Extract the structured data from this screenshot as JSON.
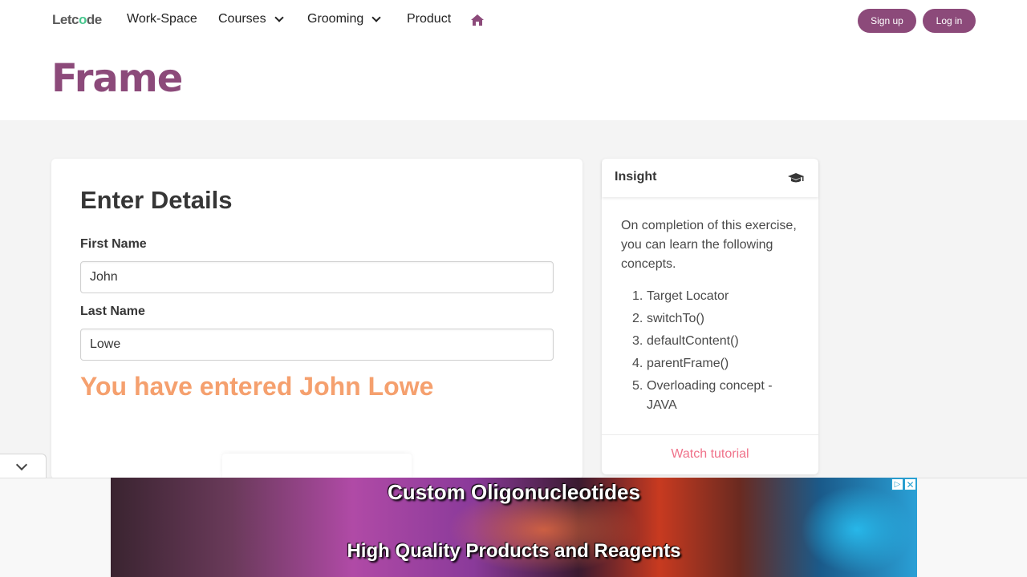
{
  "nav": {
    "logo_prefix": "Let",
    "logo_o": "o",
    "logo_suffix": "de",
    "items": [
      {
        "label": "Work-Space"
      },
      {
        "label": "Courses"
      },
      {
        "label": "Grooming"
      },
      {
        "label": "Product"
      }
    ],
    "home_icon": "home-icon",
    "signup": "Sign up",
    "login": "Log in"
  },
  "hero": {
    "title": "Frame"
  },
  "form": {
    "title": "Enter Details",
    "first_name_label": "First Name",
    "first_name_value": "John",
    "last_name_label": "Last Name",
    "last_name_value": "Lowe",
    "result": "You have entered John Lowe"
  },
  "insight": {
    "title": "Insight",
    "icon": "graduation-cap-icon",
    "description": "On completion of this exercise, you can learn the following concepts.",
    "concepts": [
      {
        "num": "1.",
        "text": "Target Locator"
      },
      {
        "num": "2.",
        "text": "switchTo()"
      },
      {
        "num": "3.",
        "text": "defaultContent()"
      },
      {
        "num": "4.",
        "text": "parentFrame()"
      },
      {
        "num": "5.",
        "text": "Overloading concept - JAVA"
      }
    ],
    "watch": "Watch tutorial"
  },
  "ad": {
    "line1": "Custom Oligonucleotides",
    "line2": "High Quality Products and Reagents",
    "info_glyph": "▷",
    "close_glyph": "✕"
  },
  "colors": {
    "brand": "#8c4a7a",
    "result": "#f5a06e",
    "link": "#f0728a",
    "section_bg": "#f4f4f4"
  }
}
